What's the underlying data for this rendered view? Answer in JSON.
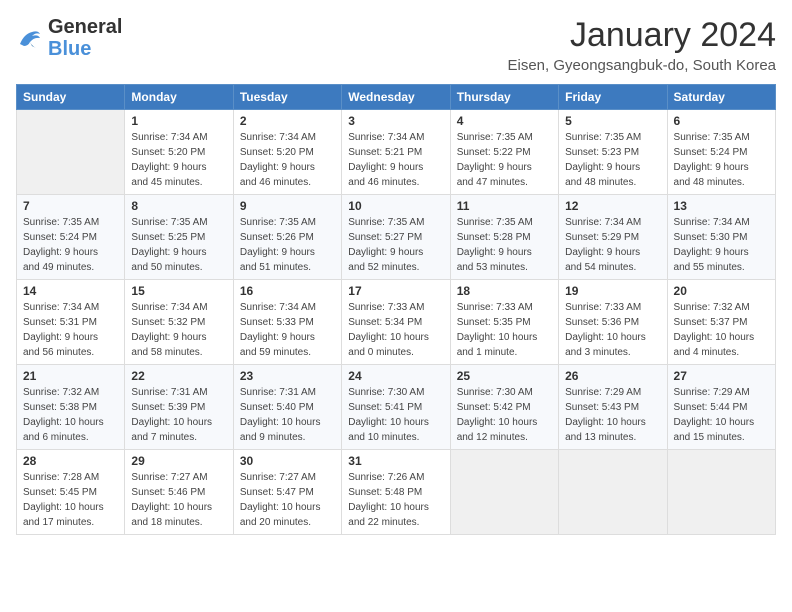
{
  "logo": {
    "text_general": "General",
    "text_blue": "Blue"
  },
  "header": {
    "title": "January 2024",
    "subtitle": "Eisen, Gyeongsangbuk-do, South Korea"
  },
  "columns": [
    "Sunday",
    "Monday",
    "Tuesday",
    "Wednesday",
    "Thursday",
    "Friday",
    "Saturday"
  ],
  "weeks": [
    [
      {
        "day": "",
        "info": ""
      },
      {
        "day": "1",
        "info": "Sunrise: 7:34 AM\nSunset: 5:20 PM\nDaylight: 9 hours\nand 45 minutes."
      },
      {
        "day": "2",
        "info": "Sunrise: 7:34 AM\nSunset: 5:20 PM\nDaylight: 9 hours\nand 46 minutes."
      },
      {
        "day": "3",
        "info": "Sunrise: 7:34 AM\nSunset: 5:21 PM\nDaylight: 9 hours\nand 46 minutes."
      },
      {
        "day": "4",
        "info": "Sunrise: 7:35 AM\nSunset: 5:22 PM\nDaylight: 9 hours\nand 47 minutes."
      },
      {
        "day": "5",
        "info": "Sunrise: 7:35 AM\nSunset: 5:23 PM\nDaylight: 9 hours\nand 48 minutes."
      },
      {
        "day": "6",
        "info": "Sunrise: 7:35 AM\nSunset: 5:24 PM\nDaylight: 9 hours\nand 48 minutes."
      }
    ],
    [
      {
        "day": "7",
        "info": "Sunrise: 7:35 AM\nSunset: 5:24 PM\nDaylight: 9 hours\nand 49 minutes."
      },
      {
        "day": "8",
        "info": "Sunrise: 7:35 AM\nSunset: 5:25 PM\nDaylight: 9 hours\nand 50 minutes."
      },
      {
        "day": "9",
        "info": "Sunrise: 7:35 AM\nSunset: 5:26 PM\nDaylight: 9 hours\nand 51 minutes."
      },
      {
        "day": "10",
        "info": "Sunrise: 7:35 AM\nSunset: 5:27 PM\nDaylight: 9 hours\nand 52 minutes."
      },
      {
        "day": "11",
        "info": "Sunrise: 7:35 AM\nSunset: 5:28 PM\nDaylight: 9 hours\nand 53 minutes."
      },
      {
        "day": "12",
        "info": "Sunrise: 7:34 AM\nSunset: 5:29 PM\nDaylight: 9 hours\nand 54 minutes."
      },
      {
        "day": "13",
        "info": "Sunrise: 7:34 AM\nSunset: 5:30 PM\nDaylight: 9 hours\nand 55 minutes."
      }
    ],
    [
      {
        "day": "14",
        "info": "Sunrise: 7:34 AM\nSunset: 5:31 PM\nDaylight: 9 hours\nand 56 minutes."
      },
      {
        "day": "15",
        "info": "Sunrise: 7:34 AM\nSunset: 5:32 PM\nDaylight: 9 hours\nand 58 minutes."
      },
      {
        "day": "16",
        "info": "Sunrise: 7:34 AM\nSunset: 5:33 PM\nDaylight: 9 hours\nand 59 minutes."
      },
      {
        "day": "17",
        "info": "Sunrise: 7:33 AM\nSunset: 5:34 PM\nDaylight: 10 hours\nand 0 minutes."
      },
      {
        "day": "18",
        "info": "Sunrise: 7:33 AM\nSunset: 5:35 PM\nDaylight: 10 hours\nand 1 minute."
      },
      {
        "day": "19",
        "info": "Sunrise: 7:33 AM\nSunset: 5:36 PM\nDaylight: 10 hours\nand 3 minutes."
      },
      {
        "day": "20",
        "info": "Sunrise: 7:32 AM\nSunset: 5:37 PM\nDaylight: 10 hours\nand 4 minutes."
      }
    ],
    [
      {
        "day": "21",
        "info": "Sunrise: 7:32 AM\nSunset: 5:38 PM\nDaylight: 10 hours\nand 6 minutes."
      },
      {
        "day": "22",
        "info": "Sunrise: 7:31 AM\nSunset: 5:39 PM\nDaylight: 10 hours\nand 7 minutes."
      },
      {
        "day": "23",
        "info": "Sunrise: 7:31 AM\nSunset: 5:40 PM\nDaylight: 10 hours\nand 9 minutes."
      },
      {
        "day": "24",
        "info": "Sunrise: 7:30 AM\nSunset: 5:41 PM\nDaylight: 10 hours\nand 10 minutes."
      },
      {
        "day": "25",
        "info": "Sunrise: 7:30 AM\nSunset: 5:42 PM\nDaylight: 10 hours\nand 12 minutes."
      },
      {
        "day": "26",
        "info": "Sunrise: 7:29 AM\nSunset: 5:43 PM\nDaylight: 10 hours\nand 13 minutes."
      },
      {
        "day": "27",
        "info": "Sunrise: 7:29 AM\nSunset: 5:44 PM\nDaylight: 10 hours\nand 15 minutes."
      }
    ],
    [
      {
        "day": "28",
        "info": "Sunrise: 7:28 AM\nSunset: 5:45 PM\nDaylight: 10 hours\nand 17 minutes."
      },
      {
        "day": "29",
        "info": "Sunrise: 7:27 AM\nSunset: 5:46 PM\nDaylight: 10 hours\nand 18 minutes."
      },
      {
        "day": "30",
        "info": "Sunrise: 7:27 AM\nSunset: 5:47 PM\nDaylight: 10 hours\nand 20 minutes."
      },
      {
        "day": "31",
        "info": "Sunrise: 7:26 AM\nSunset: 5:48 PM\nDaylight: 10 hours\nand 22 minutes."
      },
      {
        "day": "",
        "info": ""
      },
      {
        "day": "",
        "info": ""
      },
      {
        "day": "",
        "info": ""
      }
    ]
  ]
}
